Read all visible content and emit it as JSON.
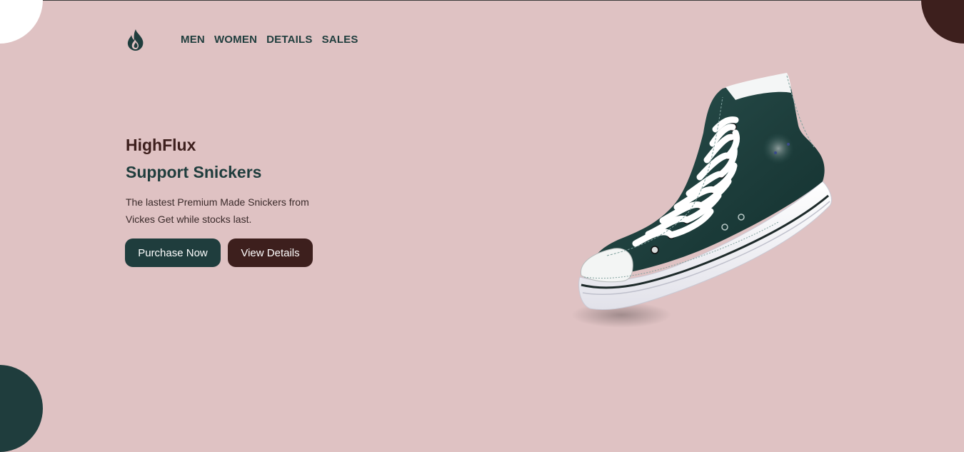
{
  "nav": {
    "items": [
      "MEN",
      "WOMEN",
      "DETAILS",
      "SALES"
    ]
  },
  "logo": {
    "icon": "flame-icon"
  },
  "hero": {
    "brand": "HighFlux",
    "headline": "Support Snickers",
    "description": "The lastest Premium Made Snickers from Vickes Get while stocks last.",
    "purchase_label": "Purchase Now",
    "details_label": "View Details",
    "image": "high-top-sneaker-image"
  },
  "colors": {
    "background": "#dfc2c3",
    "primary_dark_green": "#1f3d3d",
    "primary_dark_brown": "#3d1f1d",
    "white": "#ffffff"
  }
}
